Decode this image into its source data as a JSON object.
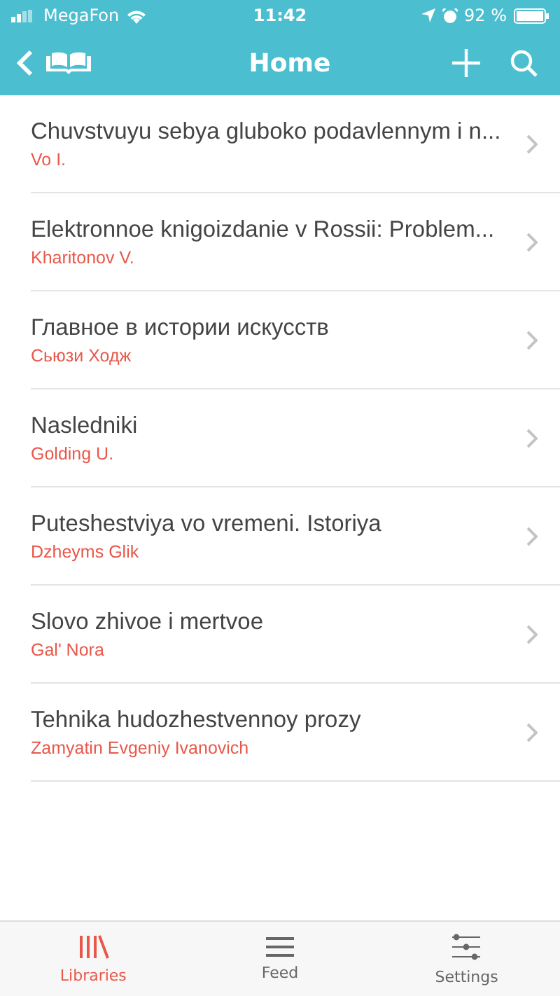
{
  "status_bar": {
    "carrier": "MegaFon",
    "time": "11:42",
    "battery": "92 %"
  },
  "nav_bar": {
    "title": "Home"
  },
  "books": [
    {
      "title": "Chuvstvuyu sebya gluboko podavlennym i n...",
      "author": "Vo I."
    },
    {
      "title": "Elektronnoe knigoizdanie v Rossii: Problem...",
      "author": "Kharitonov V."
    },
    {
      "title": "Главное в истории искусств",
      "author": "Сьюзи Ходж"
    },
    {
      "title": "Nasledniki",
      "author": "Golding U."
    },
    {
      "title": "Puteshestviya vo vremeni. Istoriya",
      "author": "Dzheyms Glik"
    },
    {
      "title": "Slovo zhivoe i mertvoe",
      "author": "Gal' Nora"
    },
    {
      "title": "Tehnika hudozhestvennoy prozy",
      "author": "Zamyatin Evgeniy Ivanovich"
    }
  ],
  "tabs": [
    {
      "label": "Libraries",
      "kind": "libraries",
      "selected": true
    },
    {
      "label": "Feed",
      "kind": "feed",
      "selected": false
    },
    {
      "label": "Settings",
      "kind": "settings",
      "selected": false
    }
  ]
}
